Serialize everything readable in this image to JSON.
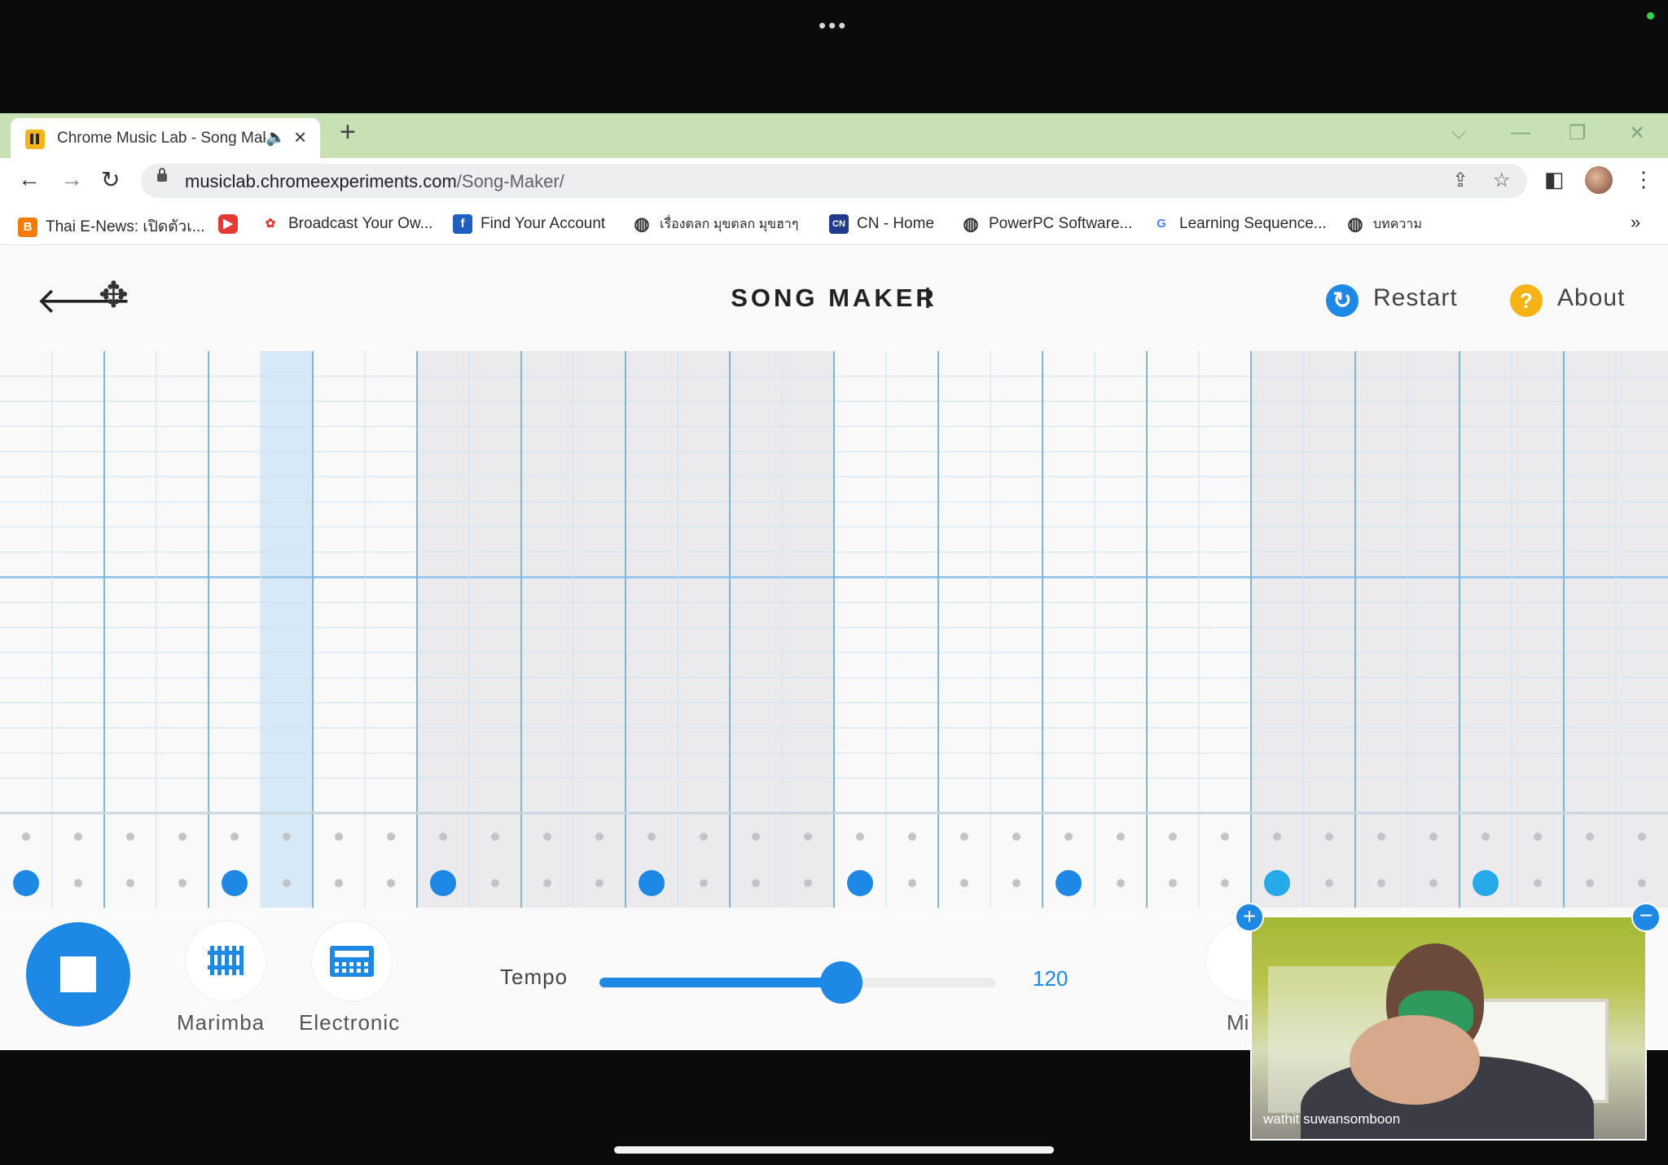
{
  "browser": {
    "tab": {
      "title": "Chrome Music Lab - Song Maker",
      "audio_icon": "speaker-icon"
    },
    "address": {
      "host": "musiclab.chromeexperiments.com",
      "path": "/Song-Maker/"
    },
    "bookmarks": [
      {
        "label": "Thai E-News: เปิดตัวเ...",
        "icon": "blogger-icon",
        "color": "#f57c00",
        "glyph": "B"
      },
      {
        "label": "",
        "icon": "youtube-icon",
        "color": "#e53935",
        "glyph": "▶"
      },
      {
        "label": "Broadcast Your Ow...",
        "icon": "broadcast-icon",
        "color": "#e53935",
        "glyph": "✿"
      },
      {
        "label": "Find Your Account",
        "icon": "facebook-icon",
        "color": "#1e5fbf",
        "glyph": "f"
      },
      {
        "label": "เรื่องตลก มุขตลก มุขฮาๆ",
        "icon": "globe-icon",
        "color": "#333333",
        "glyph": "◍"
      },
      {
        "label": "CN - Home",
        "icon": "cn-icon",
        "color": "#1f3b8a",
        "glyph": "CN"
      },
      {
        "label": "PowerPC Software...",
        "icon": "globe-icon",
        "color": "#333333",
        "glyph": "◍"
      },
      {
        "label": "Learning Sequence...",
        "icon": "google-icon",
        "color": "#4285f4",
        "glyph": "G"
      },
      {
        "label": "บทความ",
        "icon": "globe-icon",
        "color": "#333333",
        "glyph": "◍"
      }
    ],
    "overflow": "»"
  },
  "app": {
    "title": "SONG MAKER",
    "restart_label": "Restart",
    "about_label": "About",
    "accent": "#1e88e5",
    "instruments": [
      {
        "label": "Marimba",
        "icon": "marimba-icon"
      },
      {
        "label": "Electronic",
        "icon": "electronic-icon"
      }
    ],
    "tempo": {
      "label": "Tempo",
      "value": "120",
      "fraction": 0.61
    },
    "mic_label": "Mi",
    "grid": {
      "columns": 32,
      "melody_rows": 18,
      "percussion_rows": 2,
      "highlighted_column": 5,
      "shaded_bars": [
        2,
        3,
        6,
        7
      ],
      "percussion_hits": [
        0,
        4,
        8,
        12,
        16,
        20,
        24,
        28
      ]
    }
  },
  "video": {
    "name": "wathit suwansomboon"
  }
}
